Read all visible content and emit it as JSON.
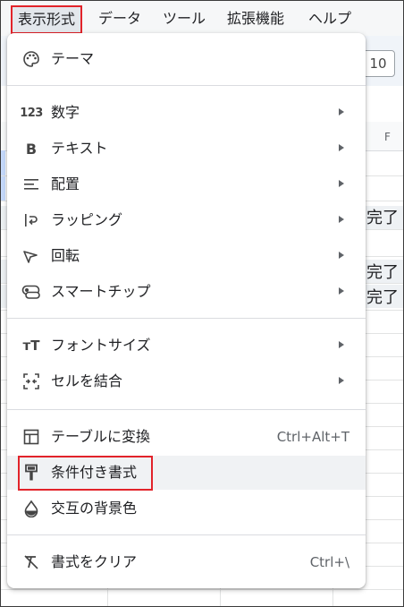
{
  "menubar": {
    "items": [
      "表示形式",
      "データ",
      "ツール",
      "拡張機能",
      "ヘルプ"
    ]
  },
  "toolbar": {
    "zoom_value": "10"
  },
  "sheet": {
    "column_header_F": "F",
    "cells": [
      "完了",
      "完了",
      "完了"
    ]
  },
  "menu": {
    "theme": "テーマ",
    "number": "数字",
    "text": "テキスト",
    "align": "配置",
    "wrap": "ラッピング",
    "rotate": "回転",
    "smart_chips": "スマートチップ",
    "font_size": "フォントサイズ",
    "merge_cells": "セルを結合",
    "convert_table": "テーブルに変換",
    "convert_table_shortcut": "Ctrl+Alt+T",
    "conditional_format": "条件付き書式",
    "alternating_colors": "交互の背景色",
    "clear_format": "書式をクリア",
    "clear_format_shortcut": "Ctrl+\\",
    "number_icon_text": "123",
    "text_icon_text": "B",
    "font_size_icon_text": "тT"
  },
  "colors": {
    "highlight_box": "#e2232a",
    "menu_bg": "#ffffff",
    "hover": "#f0f2f4"
  }
}
